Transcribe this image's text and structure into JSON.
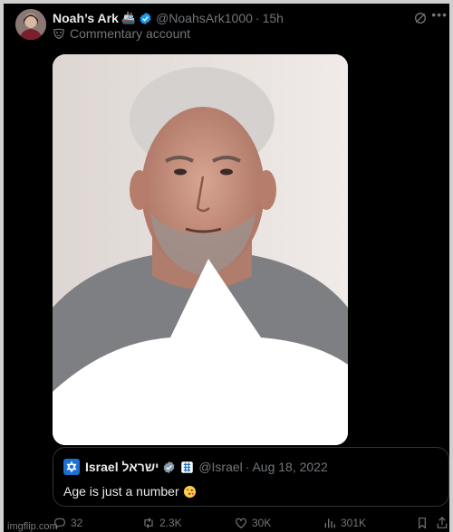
{
  "post": {
    "display_name": "Noah’s Ark",
    "name_emoji": "🚢",
    "handle": "@NoahsArk1000",
    "separator": "·",
    "time": "15h",
    "label": "Commentary account"
  },
  "quote": {
    "name": "Israel ישראל",
    "handle": "@Israel",
    "separator": "·",
    "date": "Aug 18, 2022",
    "text": "Age is just a number"
  },
  "actions": {
    "replies": "32",
    "reposts": "2.3K",
    "likes": "30K",
    "views": "301K"
  },
  "watermark": "imgflip.com",
  "colors": {
    "background": "#000000",
    "text": "#e7e9ea",
    "muted": "#71767b",
    "verified_blue": "#1d9bf0",
    "border": "#2f3336"
  },
  "icons": [
    "grok-icon",
    "more-icon",
    "verified-icon",
    "mask-icon",
    "flag-icon",
    "reply-icon",
    "repost-icon",
    "like-icon",
    "views-icon",
    "share-icon"
  ]
}
